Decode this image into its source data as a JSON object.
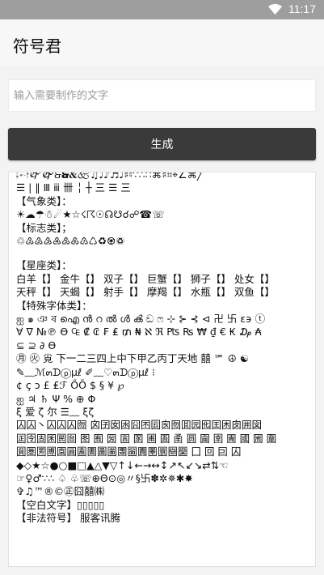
{
  "status_bar": {
    "time": "11:17"
  },
  "app_bar": {
    "title": "符号君"
  },
  "input": {
    "placeholder": "输入需要制作的文字",
    "value": ""
  },
  "generate_button": {
    "label": "生成"
  },
  "output": {
    "lines": [
      "🙭🙮🙯🙰🙱🙲🙳🙴🙵♫♩♪♬♩♯♮∵∴∷⌘♯⌗⌖∠⌘╱",
      "☰ | ‖ Ⅲ ⅲ 卌 ╎ ┼ 三 ☰ 三",
      "【气象类】：",
      "☀☁☂☃☄★☆☇☈☉☊☋☌☍☎☏",
      "【标志类】；",
      "♲♳♴♵♶♷♸♹♺♻♼♽",
      "",
      "【星座类】：",
      "白羊【】 金牛【】 双子【】 巨蟹【】 狮子【】 处女【】",
      "天秤【】 天蝎【】 射手【】 摩羯【】 水瓶【】 双鱼【】",
      " 【特殊字体类】：",
      "ஐ ๑ ঞ ৰ ഐ ൻ റ ൽ ൾ ൿ ඞ ෆ ⊹ ⊱ ⊰ ⊲ 卍 卐 ε϶ ⓣ",
      "∀ ∇ №℗ ϴ ₠ ₡ ₢ ₣ ₤ ₥ ₦ ℵ ℜ ₧ ₨ ₩ ₫ € ₭ ₯ ₳",
      "⊆ ⊇ ∂ ϴ",
      "㊊ ㊋ 㝸 下一二三四上中下甲乙丙丁天地 囍 ℠ ☮ ☯",
      "✎﹏ℳ๓ᗪⓟμℓ ✐﹏♡๓ᗪⓟμℓ ⁝",
      "¢ ç ↄ £ ₤ℱ ŐŌ $ § ¥ ℘",
      "ஐ ♃ ♄ Ψ % ⊕ Φ",
      "ξ 爱 ζ 尔 ☰﹏ ξζ",
      " 囚囚丶囚囚囚囫 囟囝囡囦囧囨囩囪囫囬园囮囯困囱囲図",
      "囸囹固囷囻囼 图 囿 圀 圁 圂 圃 圄 圅 圆 圇 圉 圊 國 圌 圍",
      "圎圏圐圑園圓圔圕圖圗團圙圚圛圜圝圞 囗 回 囙 囚",
      "◆◇★☆●○■□▲△▼▽↑↓←→↔↕↗↖↙↘⇄⇅☜",
      "☞♀♂∵∴ ♤ ♧☏⊕Θ⊙◎〃§卐✽✲✵✱✸",
      "✞♫™®©㊣囧囍㈱",
      "【空白文字】▯▯▯▯▯",
      "【非法符号】 服客讯腾"
    ]
  },
  "colors": {
    "status_bar": "#9e9e9e",
    "app_bar": "#f7f7f7",
    "page_bg": "#f3f3f3",
    "button_bg": "#3a3a3a",
    "button_text": "#ffffff"
  },
  "icons": {
    "status_wifi": "wifi-icon"
  }
}
